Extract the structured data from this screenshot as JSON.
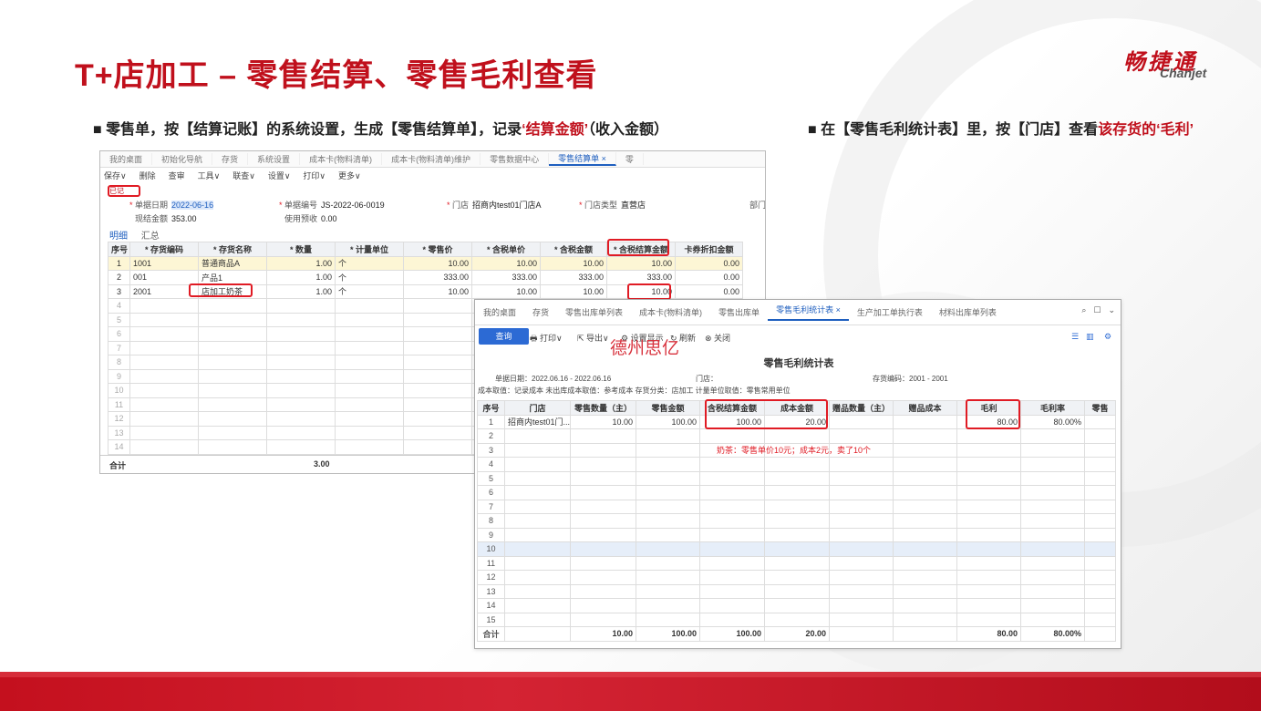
{
  "slide": {
    "title": "T+店加工 – 零售结算、零售毛利查看",
    "logo_cn": "畅捷通",
    "logo_en": "Chanjet",
    "bullet1_prefix": "零售单，按【结算记账】的系统设置，生成【零售结算单】，记录",
    "bullet1_highlight": "‘结算金额’",
    "bullet1_suffix": "（收入金额）",
    "bullet2_prefix": "在【零售毛利统计表】里，按【门店】查看",
    "bullet2_highlight": "该存货的‘毛利’"
  },
  "win1": {
    "tabs": [
      "我的桌面",
      "初始化导航",
      "存货",
      "系统设置",
      "成本卡(物料清单)",
      "成本卡(物料清单)维护",
      "零售数据中心",
      "零售结算单 ×",
      "零"
    ],
    "toolbar": [
      "保存∨",
      "删除",
      "查审",
      "工具∨",
      "联查∨",
      "设置∨",
      "打印∨",
      "更多∨"
    ],
    "status": "已记",
    "date_label": "单据日期",
    "date_value": "2022-06-16",
    "code_label": "单据编号",
    "code_value": "JS-2022-06-0019",
    "store_label": "门店",
    "store_value": "招商内test01门店A",
    "store_type_label": "门店类型",
    "store_type_value": "直营店",
    "dept_label": "部门",
    "settle_label": "现结金额",
    "settle_value": "353.00",
    "prepay_label": "使用预收",
    "prepay_value": "0.00",
    "subtab_on": "明细",
    "subtab_off": "汇总",
    "headers": [
      "序号",
      "存货编码",
      "存货名称",
      "数量",
      "计量单位",
      "零售价",
      "含税单价",
      "含税金额",
      "含税结算金额",
      "卡券折扣金额"
    ],
    "rows": [
      [
        "1",
        "1001",
        "普通商品A",
        "1.00",
        "个",
        "10.00",
        "10.00",
        "10.00",
        "10.00",
        "0.00"
      ],
      [
        "2",
        "001",
        "产品1",
        "1.00",
        "个",
        "333.00",
        "333.00",
        "333.00",
        "333.00",
        "0.00"
      ],
      [
        "3",
        "2001",
        "店加工奶茶",
        "1.00",
        "个",
        "10.00",
        "10.00",
        "10.00",
        "10.00",
        "0.00"
      ]
    ],
    "empty_rows": [
      "4",
      "5",
      "6",
      "7",
      "8",
      "9",
      "10",
      "11",
      "12",
      "13",
      "14"
    ],
    "total_label": "合计",
    "total_qty": "3.00"
  },
  "win2": {
    "tabs": [
      "我的桌面",
      "存货",
      "零售出库单列表",
      "成本卡(物料清单)",
      "零售出库单",
      "零售毛利统计表 ×",
      "生产加工单执行表",
      "材料出库单列表"
    ],
    "query_btn": "查询",
    "toolbar": [
      "打印∨",
      "导出∨",
      "设置显示",
      "刷新",
      "关闭"
    ],
    "watermark": "德州思亿",
    "report_title": "零售毛利统计表",
    "meta_date": "单据日期：2022.06.16 - 2022.06.16",
    "meta_store": "门店：",
    "meta_inv": "存货编码：2001 - 2001",
    "meta_line2": "成本取值：记录成本    未出库成本取值：参考成本    存货分类：店加工    计量单位取值：零售常用单位",
    "headers": [
      "序号",
      "门店",
      "零售数量（主）",
      "零售金额",
      "含税结算金额",
      "成本金额",
      "赠品数量（主）",
      "赠品成本",
      "毛利",
      "毛利率",
      "零售"
    ],
    "row1": [
      "1",
      "招商内test01门...",
      "10.00",
      "100.00",
      "100.00",
      "20.00",
      "",
      "",
      "80.00",
      "80.00%",
      ""
    ],
    "empty_rows": [
      "2",
      "3",
      "4",
      "5",
      "6",
      "7",
      "8",
      "9",
      "10",
      "11",
      "12",
      "13",
      "14",
      "15"
    ],
    "note": "奶茶：零售单价10元；成本2元，卖了10个",
    "total": [
      "合计",
      "",
      "10.00",
      "100.00",
      "100.00",
      "20.00",
      "",
      "",
      "80.00",
      "80.00%",
      ""
    ]
  }
}
